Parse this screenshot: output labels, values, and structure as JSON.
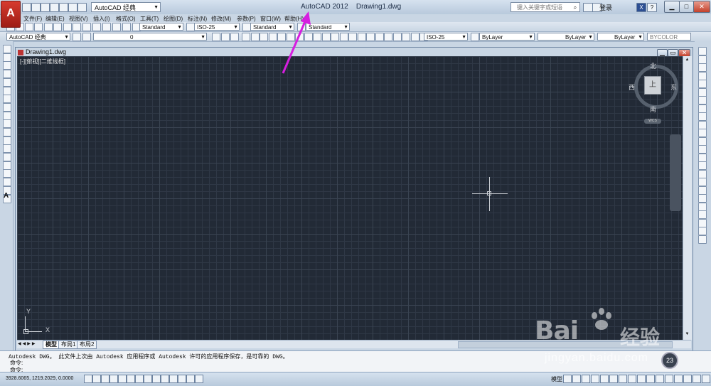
{
  "app": {
    "logo": "A",
    "title": "AutoCAD 2012",
    "document": "Drawing1.dwg",
    "workspace": "AutoCAD 经典",
    "search_placeholder": "键入关键字或短语",
    "signin": "登录"
  },
  "menus": [
    "文件(F)",
    "编辑(E)",
    "视图(V)",
    "插入(I)",
    "格式(O)",
    "工具(T)",
    "绘图(D)",
    "标注(N)",
    "修改(M)",
    "参数(P)",
    "窗口(W)",
    "帮助(H)"
  ],
  "styles_toolbar": {
    "text_style": "Standard",
    "dim_style": "ISO-25",
    "table_style": "Standard",
    "mleader_style": "Standard"
  },
  "layers_toolbar": {
    "workspace": "AutoCAD 经典",
    "layer": "0",
    "dim_style2": "ISO-25",
    "color": "ByLayer",
    "linetype": "ByLayer",
    "lineweight": "ByLayer",
    "plotstyle": "BYCOLOR"
  },
  "drawing": {
    "window_title": "Drawing1.dwg",
    "viewport_label": "[-][俯视][二维线框]",
    "viewcube": {
      "north": "北",
      "south": "南",
      "east": "东",
      "west": "西",
      "top": "上",
      "wcs": "WCS"
    },
    "ucs": {
      "x": "X",
      "y": "Y"
    }
  },
  "layout_tabs": [
    "模型",
    "布局1",
    "布局2"
  ],
  "command": {
    "history": "Autodesk DWG。  此文件上次由 Autodesk 应用程序或 Autodesk 许可的应用程序保存，是可靠的 DWG。",
    "prompt1": "命令:",
    "prompt2": "命令:"
  },
  "status": {
    "coords": "3928.6065, 1219.2029, 0.0000",
    "model": "模型"
  },
  "watermark": {
    "brand": "Bai",
    "brand2": "经验",
    "url": "jingyan.baidu.com",
    "badge": "23"
  },
  "colors": {
    "canvas": "#222a36",
    "accent_arrow": "#d61ee0"
  }
}
